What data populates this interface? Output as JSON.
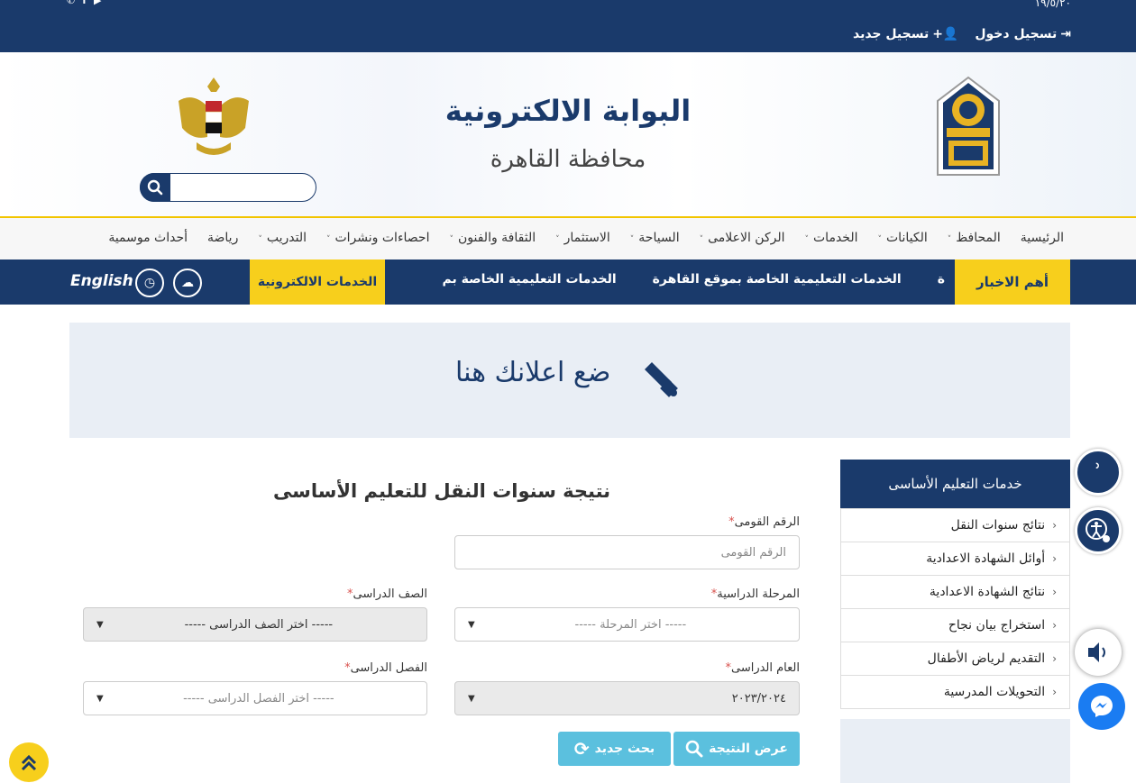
{
  "topbar": {
    "date": "١٩/٥/٢٠",
    "login": "تسجيل دخول",
    "register": "تسجيل جديد"
  },
  "header": {
    "title": "البوابة الالكترونية",
    "subtitle": "محافظة القاهرة"
  },
  "nav": {
    "items": [
      {
        "label": "الرئيسية",
        "dropdown": false
      },
      {
        "label": "المحافظ",
        "dropdown": true
      },
      {
        "label": "الكيانات",
        "dropdown": true
      },
      {
        "label": "الخدمات",
        "dropdown": true
      },
      {
        "label": "الركن الاعلامى",
        "dropdown": true
      },
      {
        "label": "السياحة",
        "dropdown": true
      },
      {
        "label": "الاستثمار",
        "dropdown": true
      },
      {
        "label": "الثقافة والفنون",
        "dropdown": true
      },
      {
        "label": "احصاءات ونشرات",
        "dropdown": true
      },
      {
        "label": "التدريب",
        "dropdown": true
      },
      {
        "label": "رياضة",
        "dropdown": false
      },
      {
        "label": "أحداث موسمية",
        "dropdown": false
      }
    ]
  },
  "newsbar": {
    "label": "أهم الاخبار",
    "items": [
      "ة",
      "الخدمات التعليمية الخاصة بموقع القاهرة",
      "الخدمات التعليمية الخاصة بم"
    ],
    "eservices": "الخدمات الالكترونية",
    "english": "English"
  },
  "ad": {
    "text": "ضع اعلانك هنا"
  },
  "sidebar": {
    "title": "خدمات التعليم الأساسى",
    "items": [
      "نتائج سنوات النقل",
      "أوائل الشهادة الاعدادية",
      "نتائج الشهادة الاعدادية",
      "استخراج بيان نجاح",
      "التقديم لرياض الأطفال",
      "التحويلات المدرسية"
    ]
  },
  "form": {
    "title": "نتيجة سنوات النقل للتعليم الأساسى",
    "national_id": {
      "label": "الرقم القومى",
      "placeholder": "الرقم القومى"
    },
    "stage": {
      "label": "المرحلة الدراسية",
      "value": "----- اختر المرحلة -----"
    },
    "grade": {
      "label": "الصف الدراسى",
      "value": "----- اختر الصف الدراسى -----"
    },
    "year": {
      "label": "العام الدراسى",
      "value": "٢٠٢٣/٢٠٢٤"
    },
    "term": {
      "label": "الفصل الدراسى",
      "value": "----- اختر الفصل الدراسى -----"
    },
    "required_mark": "*",
    "show_result": "عرض النتيجة",
    "new_search": "بحث جديد"
  },
  "colors": {
    "primary": "#1a3a6b",
    "accent": "#f7cf1c",
    "button": "#5bc0de"
  }
}
